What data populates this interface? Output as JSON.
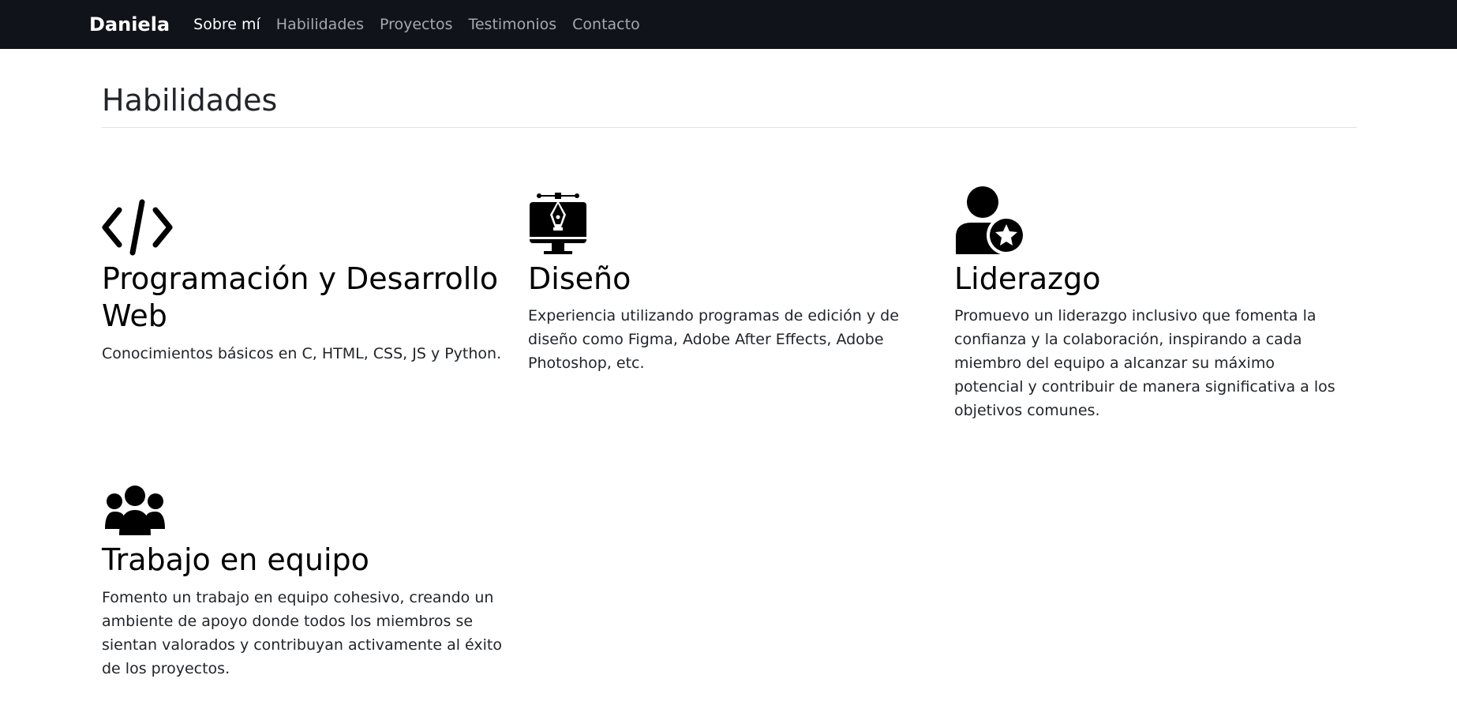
{
  "nav": {
    "brand": "Daniela",
    "links": [
      "Sobre mí",
      "Habilidades",
      "Proyectos",
      "Testimonios",
      "Contacto"
    ]
  },
  "section": {
    "title": "Habilidades"
  },
  "skills": [
    {
      "icon": "code-icon",
      "title": "Programación y Desarrollo Web",
      "description": "Conocimientos básicos en C, HTML, CSS, JS y Python."
    },
    {
      "icon": "design-monitor-icon",
      "title": "Diseño",
      "description": "Experiencia utilizando programas de edición y de diseño como Figma, Adobe After Effects, Adobe Photoshop, etc."
    },
    {
      "icon": "user-star-icon",
      "title": "Liderazgo",
      "description": "Promuevo un liderazgo inclusivo que fomenta la confianza y la colaboración, inspirando a cada miembro del equipo a alcanzar su máximo potencial y contribuir de manera significativa a los objetivos comunes."
    },
    {
      "icon": "users-group-icon",
      "title": "Trabajo en equipo",
      "description": "Fomento un trabajo en equipo cohesivo, creando un ambiente de apoyo donde todos los miembros se sientan valorados y contribuyan activamente al éxito de los proyectos."
    }
  ]
}
